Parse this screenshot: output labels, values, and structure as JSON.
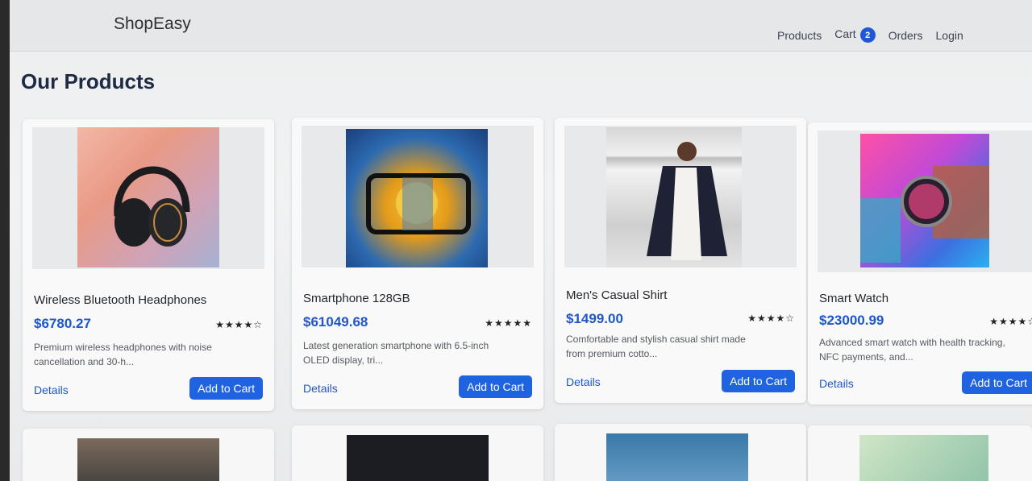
{
  "navbar": {
    "brand": "ShopEasy",
    "links": {
      "products": "Products",
      "cart": "Cart",
      "cart_count": "2",
      "orders": "Orders",
      "login": "Login"
    }
  },
  "page": {
    "title": "Our Products"
  },
  "products": [
    {
      "name": "Wireless Bluetooth Headphones",
      "price": "$6780.27",
      "rating": "★★★★☆",
      "description": "Premium wireless headphones with noise cancellation and 30-h...",
      "details_label": "Details",
      "cart_label": "Add to Cart"
    },
    {
      "name": "Smartphone 128GB",
      "price": "$61049.68",
      "rating": "★★★★★",
      "description": "Latest generation smartphone with 6.5-inch OLED display, tri...",
      "details_label": "Details",
      "cart_label": "Add to Cart"
    },
    {
      "name": "Men's Casual Shirt",
      "price": "$1499.00",
      "rating": "★★★★☆",
      "description": "Comfortable and stylish casual shirt made from premium cotto...",
      "details_label": "Details",
      "cart_label": "Add to Cart"
    },
    {
      "name": "Smart Watch",
      "price": "$23000.99",
      "rating": "★★★★☆",
      "description": "Advanced smart watch with health tracking, NFC payments, and...",
      "details_label": "Details",
      "cart_label": "Add to Cart"
    }
  ],
  "colors": {
    "accent": "#1f63e0",
    "price": "#1f57c9",
    "badge": "#1f57d6"
  }
}
